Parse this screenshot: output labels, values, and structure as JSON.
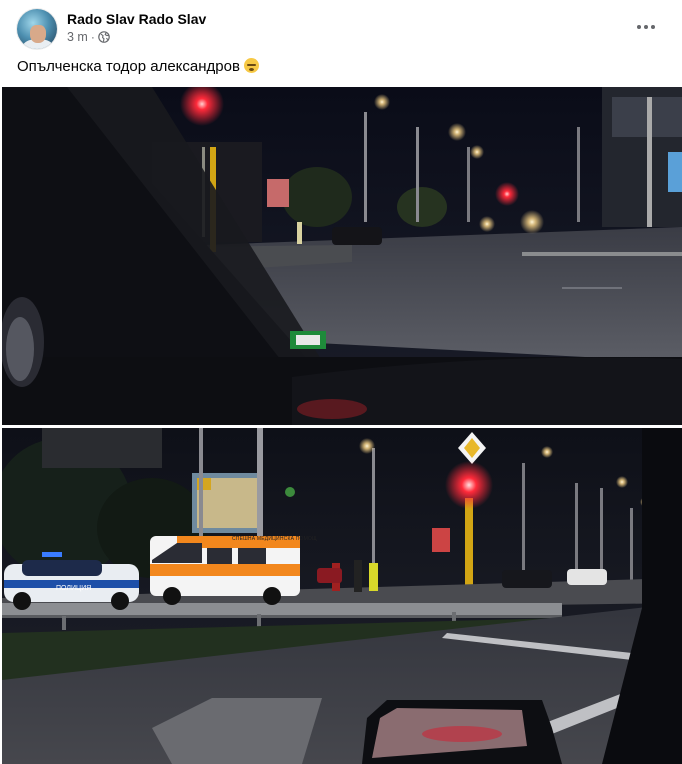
{
  "post": {
    "author": "Rado Slav Rado Slav",
    "time": "3 m",
    "separator": "·",
    "audience_icon": "globe-icon",
    "more_icon": "more-options-icon",
    "caption": "Опълченска тодор александров",
    "caption_emoji": "sad-face-emoji"
  },
  "photos": [
    {
      "name": "night-intersection-from-car-photo",
      "sign_text": ""
    },
    {
      "name": "accident-scene-photo",
      "ambulance_label": "СПЕШНА МЕДИЦИНСКА ПОМОЩ",
      "police_label": "ПОЛИЦИЯ"
    }
  ],
  "colors": {
    "meta_text": "#65676b",
    "name_text": "#050505",
    "traffic_red": "#ff2a3a",
    "ambulance_orange": "#f2871d"
  }
}
